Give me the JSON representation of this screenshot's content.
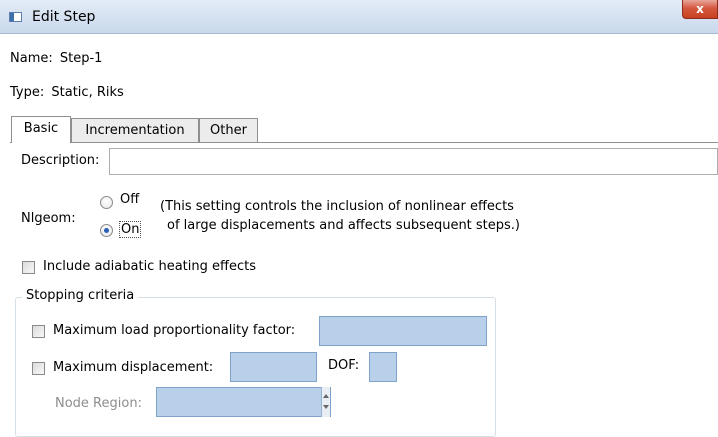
{
  "window": {
    "title": "Edit Step",
    "close_label": "x"
  },
  "step": {
    "name_label": "Name:",
    "name_value": "Step-1",
    "type_label": "Type:",
    "type_value": "Static, Riks"
  },
  "tabs": [
    {
      "label": "Basic",
      "active": true
    },
    {
      "label": "Incrementation",
      "active": false
    },
    {
      "label": "Other",
      "active": false
    }
  ],
  "basic": {
    "description_label": "Description:",
    "description_value": "",
    "nlgeom_label": "Nlgeom:",
    "nlgeom_options": {
      "off": "Off",
      "on": "On"
    },
    "nlgeom_selected": "On",
    "nlgeom_note_line1": "(This setting controls the inclusion of nonlinear effects",
    "nlgeom_note_line2": "of large displacements and affects subsequent steps.)",
    "adiabatic_label": "Include adiabatic heating effects",
    "adiabatic_checked": false
  },
  "stopping": {
    "title": "Stopping criteria",
    "max_lpf_label": "Maximum load proportionality factor:",
    "max_lpf_checked": false,
    "max_lpf_value": "",
    "max_disp_label": "Maximum displacement:",
    "max_disp_checked": false,
    "max_disp_value": "",
    "dof_label": "DOF:",
    "dof_value": "",
    "node_region_label": "Node Region:",
    "node_region_value": ""
  },
  "colors": {
    "field_fill": "#b8d0ea",
    "radio_selected": "#2a5fb5",
    "titlebar": "#d6e2f1"
  }
}
